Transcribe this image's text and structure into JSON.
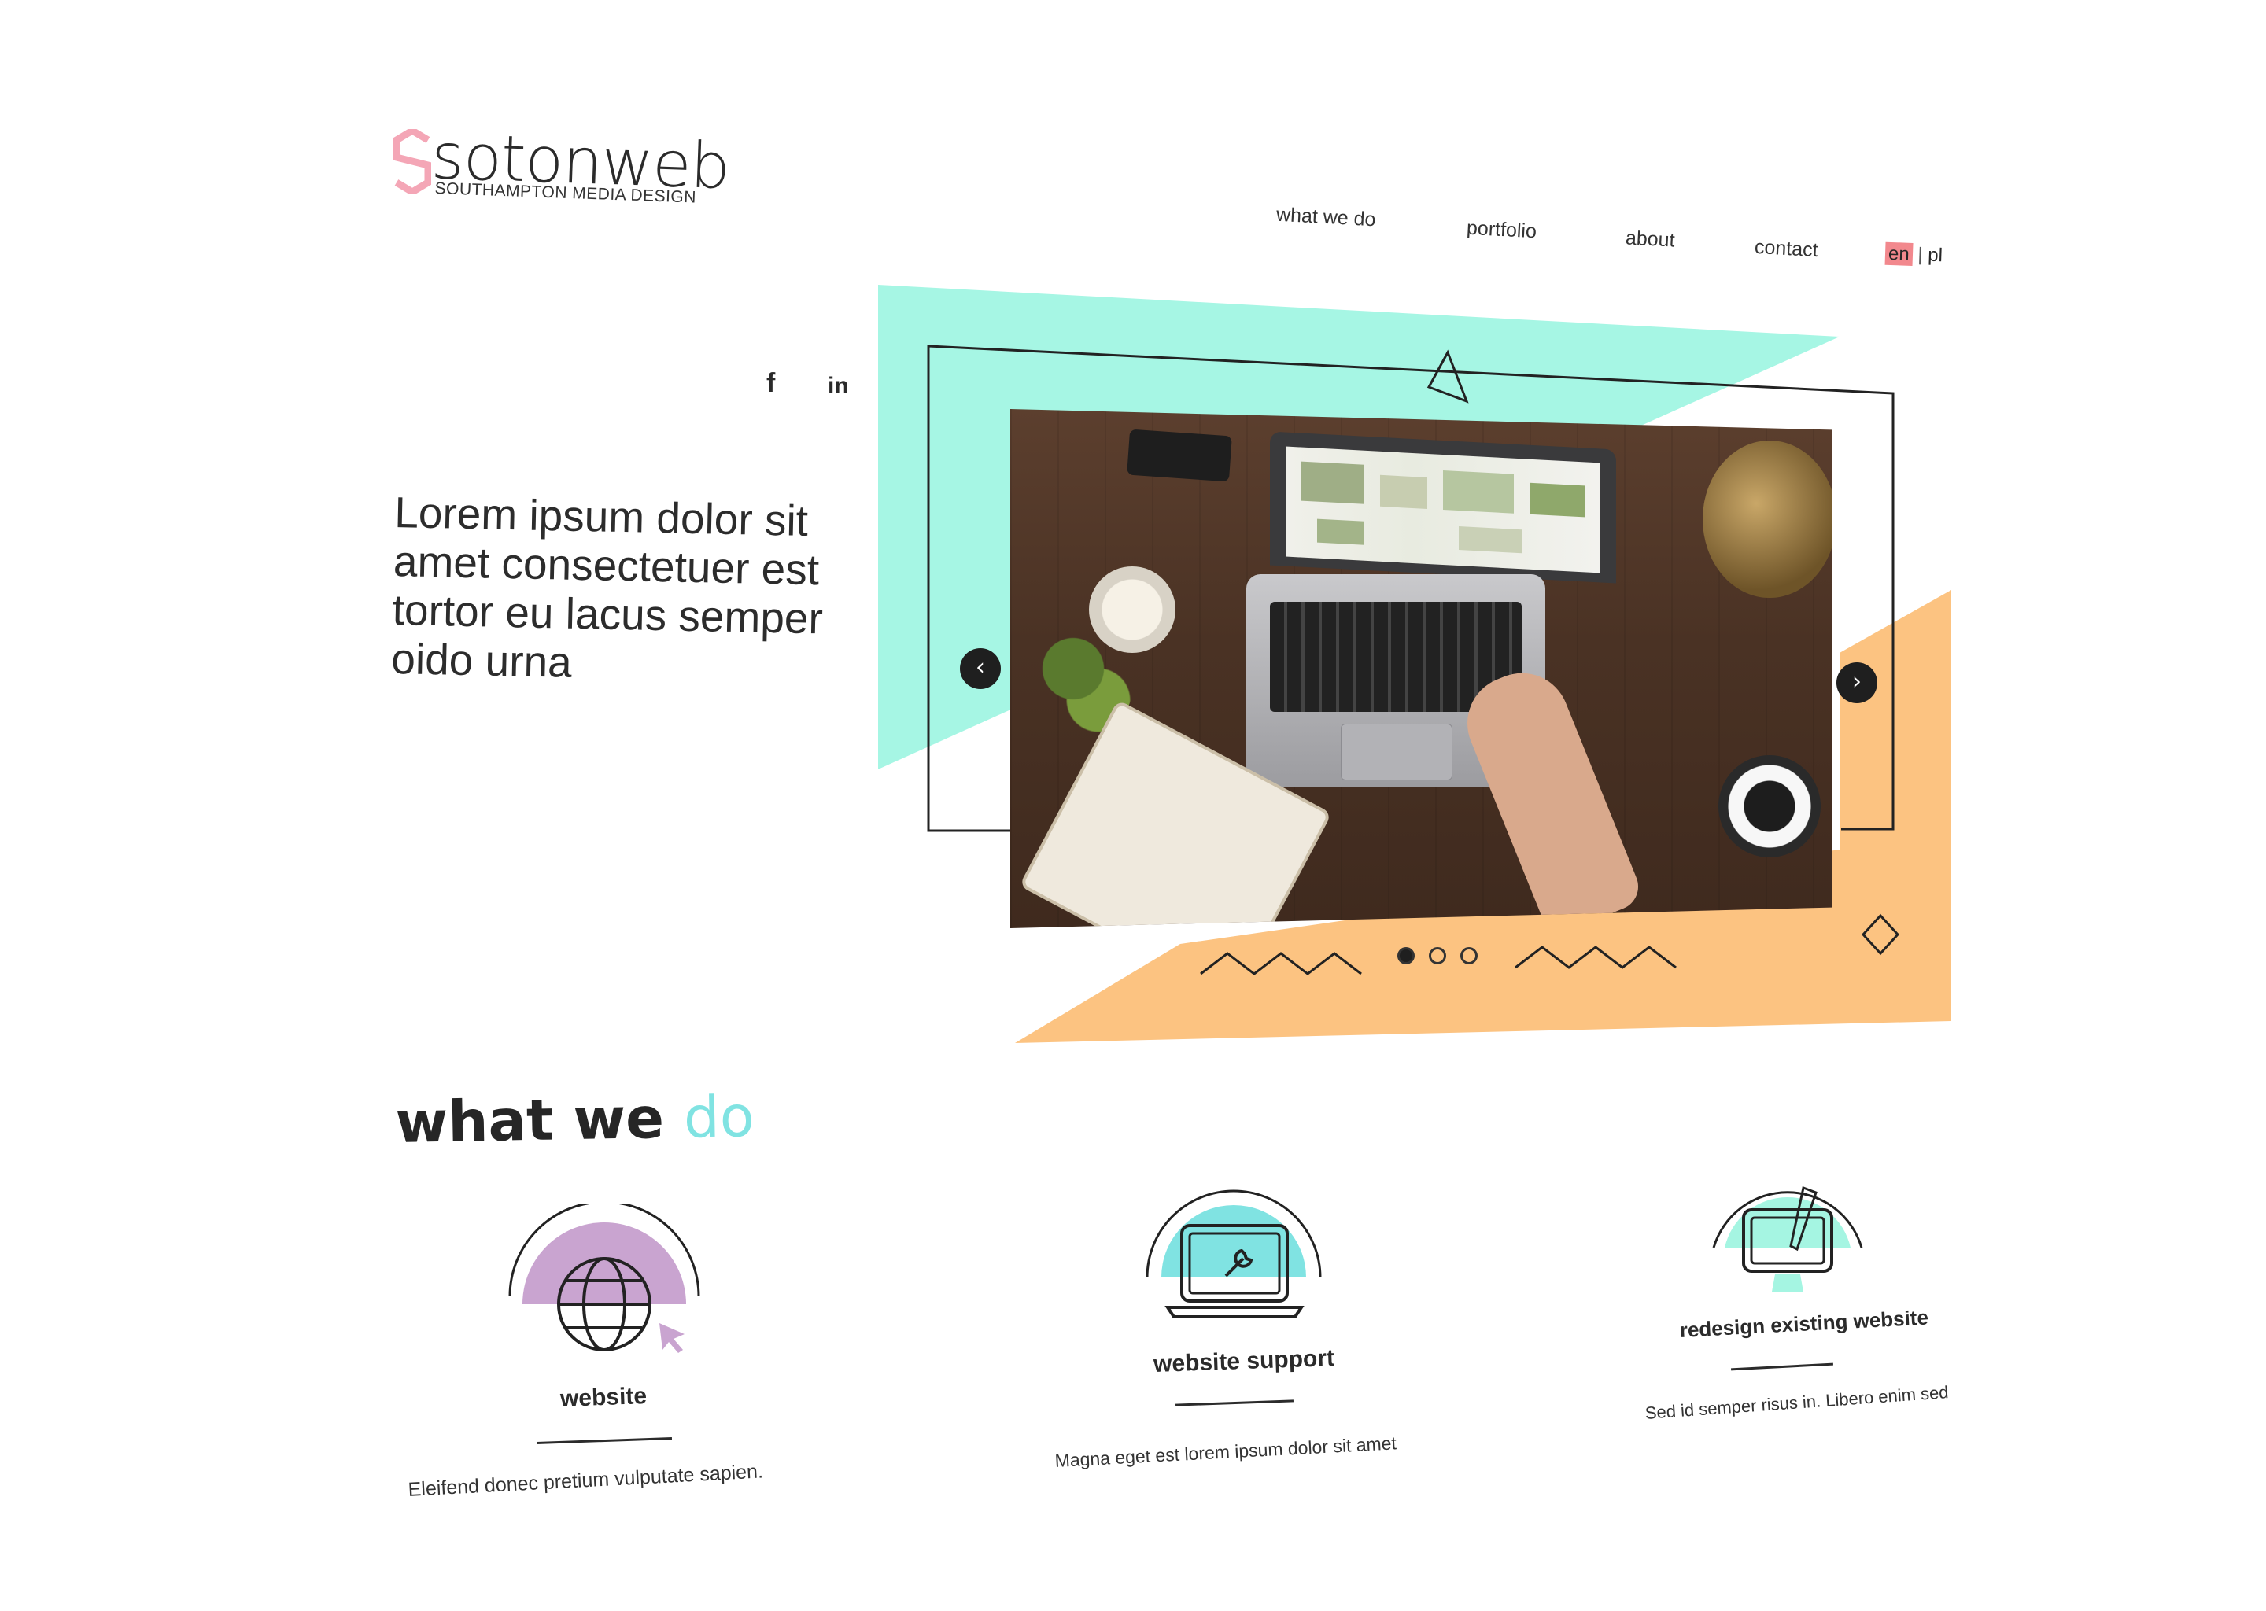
{
  "logo": {
    "name": "sotonweb",
    "tagline": "SOUTHAMPTON MEDIA DESIGN",
    "mark": "s-hexagon-logo"
  },
  "nav": {
    "items": [
      {
        "label": "what we do"
      },
      {
        "label": "portfolio"
      },
      {
        "label": "about"
      },
      {
        "label": "contact"
      }
    ],
    "lang_active": "en",
    "lang_separator": "|",
    "lang_other": "pl"
  },
  "social": {
    "facebook": "f",
    "linkedin": "in"
  },
  "hero": {
    "lines": [
      "Lorem ipsum dolor sit",
      "amet consectetuer est",
      "tortor eu lacus semper",
      "oido urna"
    ]
  },
  "slider": {
    "prev_icon": "chevron-left-icon",
    "next_icon": "chevron-right-icon",
    "slide_count": 3,
    "active_slide": 1
  },
  "services_section": {
    "title_main": "what we",
    "title_accent": "do"
  },
  "services": [
    {
      "name": "website",
      "description": "Eleifend donec pretium vulputate sapien.",
      "icon": "globe-cursor-icon",
      "accent": "#c9a4d0"
    },
    {
      "name": "website support",
      "description": "Magna eget est lorem ipsum dolor sit amet",
      "icon": "laptop-wrench-icon",
      "accent": "#80e3e2"
    },
    {
      "name": "redesign existing website",
      "description": "Sed id semper risus in. Libero enim sed",
      "icon": "tablet-brush-icon",
      "accent": "#a5f5e2"
    }
  ],
  "colors": {
    "mint": "#a6f6e4",
    "orange": "#fcc381",
    "aqua": "#80e3e2",
    "lilac": "#c9a4d0",
    "lang_highlight": "#f2888d",
    "logo_pink": "#f4a6b6"
  }
}
